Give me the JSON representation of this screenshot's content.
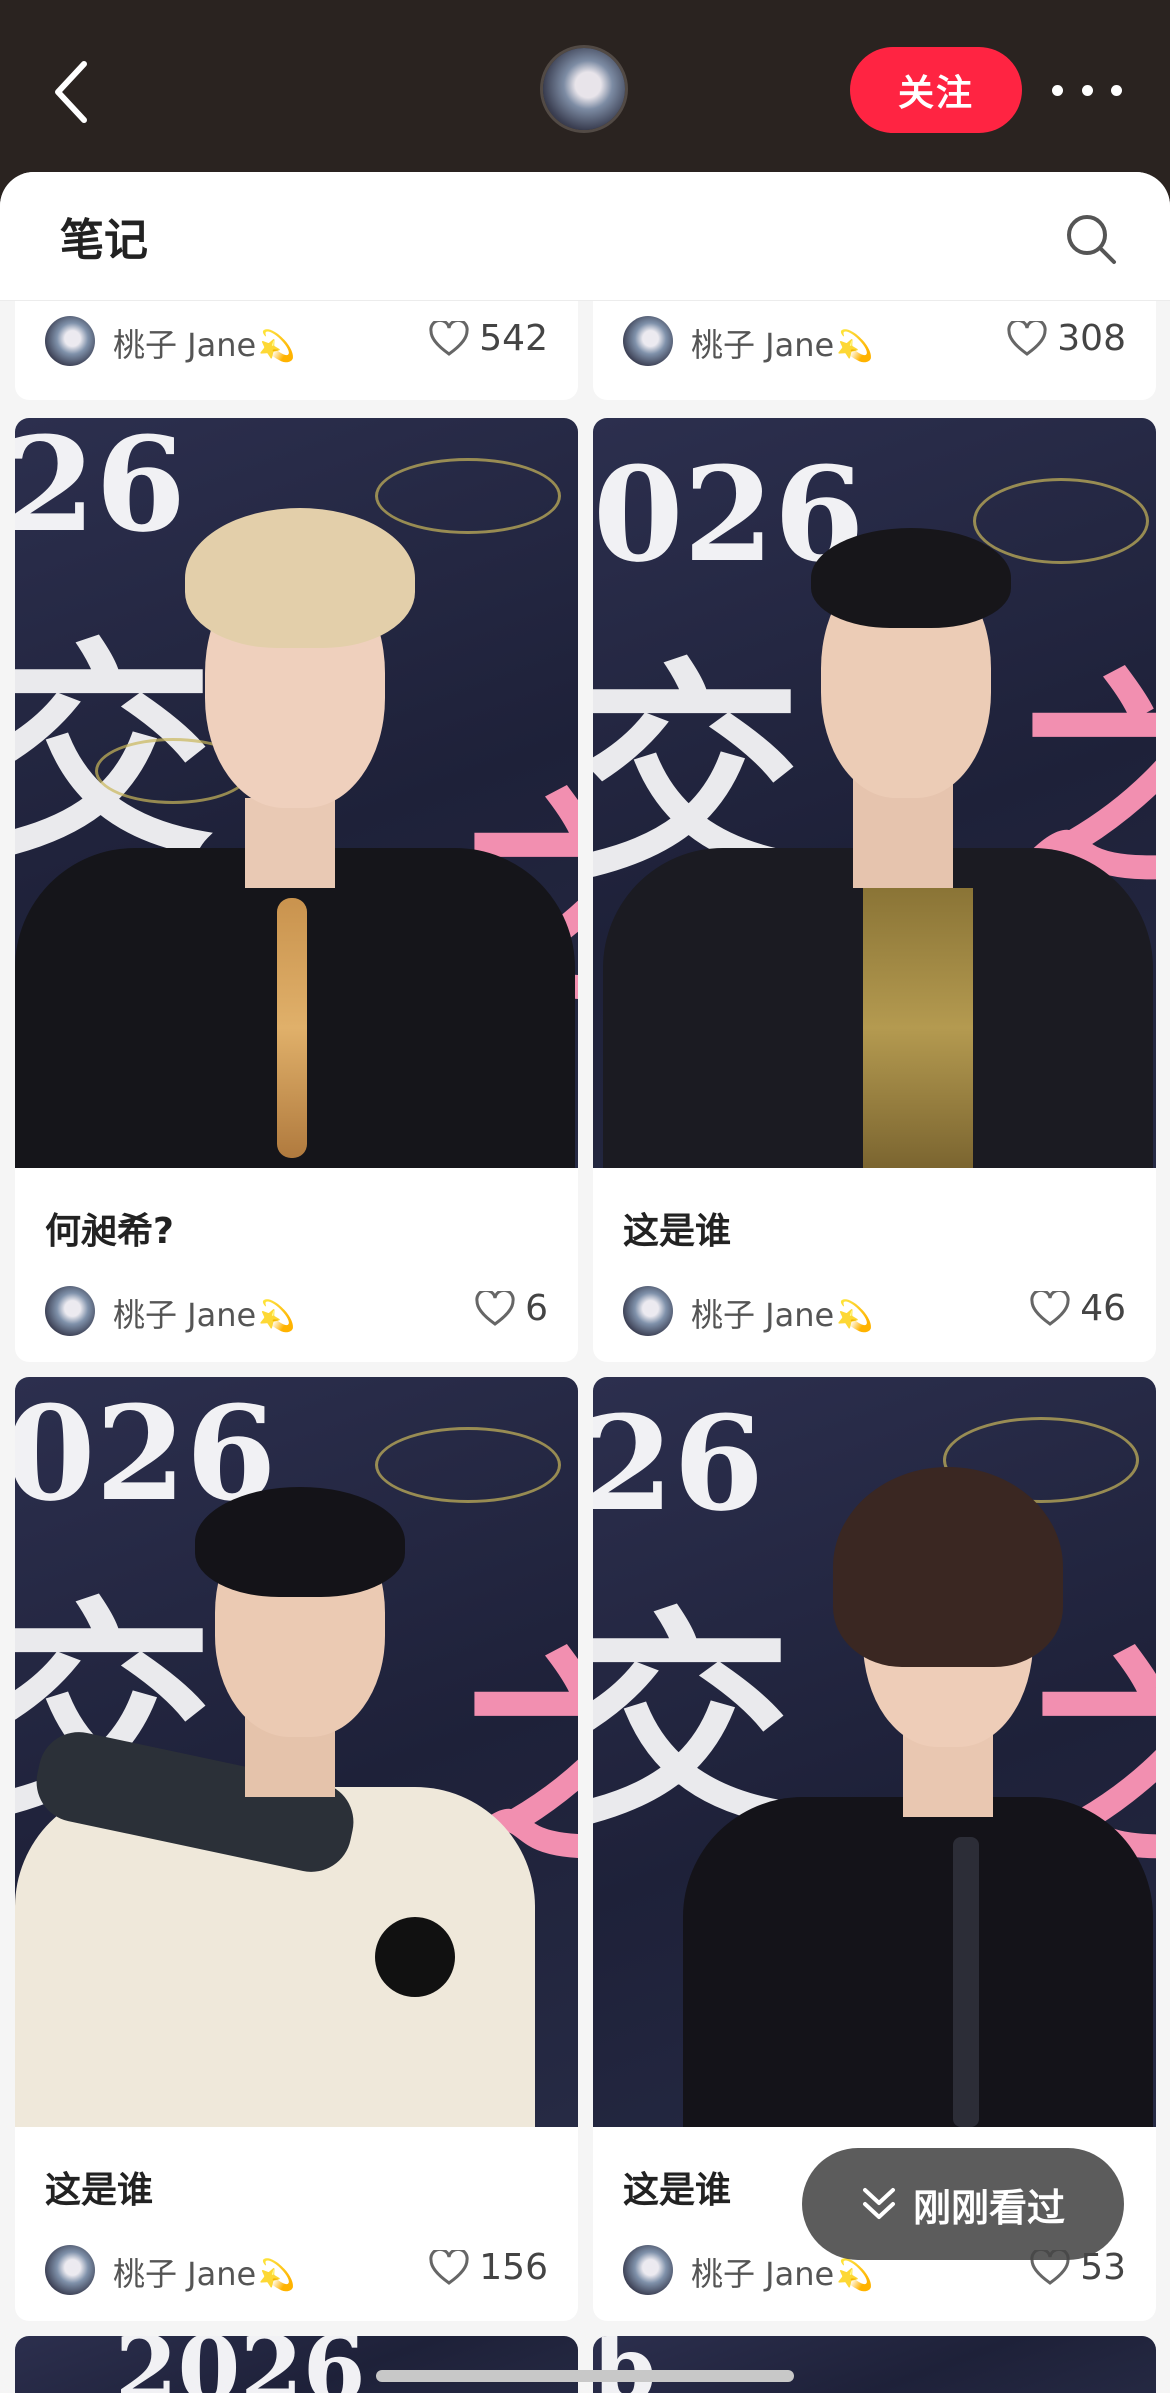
{
  "header": {
    "follow_label": "关注"
  },
  "panel": {
    "title": "笔记"
  },
  "notes_top": [
    {
      "author": "桃子 Jane",
      "likes": "542"
    },
    {
      "author": "桃子 Jane",
      "likes": "308"
    }
  ],
  "notes": [
    {
      "title": "何昶希?",
      "author": "桃子 Jane",
      "likes": "6"
    },
    {
      "title": "这是谁",
      "author": "桃子 Jane",
      "likes": "46"
    },
    {
      "title": "这是谁",
      "author": "桃子 Jane",
      "likes": "156"
    },
    {
      "title": "这是谁",
      "author": "桃子 Jane",
      "likes": "53"
    }
  ],
  "recent": {
    "label": "刚刚看过"
  },
  "colors": {
    "accent": "#ff2442",
    "background_dark": "#2a2320"
  },
  "icons": [
    "back-arrow-icon",
    "more-dots-icon",
    "search-icon",
    "heart-icon",
    "chevron-double-down-icon",
    "shooting-star-emoji"
  ]
}
